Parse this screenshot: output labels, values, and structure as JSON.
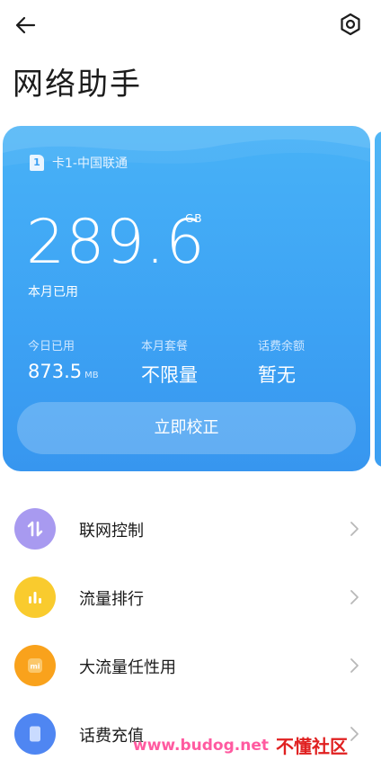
{
  "header": {
    "title": "网络助手",
    "back_icon": "arrow-left-icon",
    "settings_icon": "settings-hexagon-icon"
  },
  "card": {
    "sim_badge": "1",
    "sim_label": "卡1-中国联通",
    "usage_value": "289.6",
    "usage_unit": "GB",
    "usage_caption": "本月已用",
    "stats": [
      {
        "label": "今日已用",
        "value": "873.5",
        "unit": "MB"
      },
      {
        "label": "本月套餐",
        "value": "不限量"
      },
      {
        "label": "话费余额",
        "value": "暂无"
      }
    ],
    "action_label": "立即校正",
    "colors": {
      "card_top": "#48b2f7",
      "card_bottom": "#3796ef"
    }
  },
  "menu": [
    {
      "label": "联网控制",
      "icon": "up-down-arrows-icon",
      "color": "#a89af0"
    },
    {
      "label": "流量排行",
      "icon": "bar-chart-icon",
      "color": "#f9cb2e"
    },
    {
      "label": "大流量任性用",
      "icon": "mi-logo-icon",
      "color": "#f9a21c"
    },
    {
      "label": "话费充值",
      "icon": "phone-card-icon",
      "color": "#4f86f2"
    }
  ],
  "watermark": {
    "url": "www.budog.net",
    "site_name": "不懂社区"
  }
}
